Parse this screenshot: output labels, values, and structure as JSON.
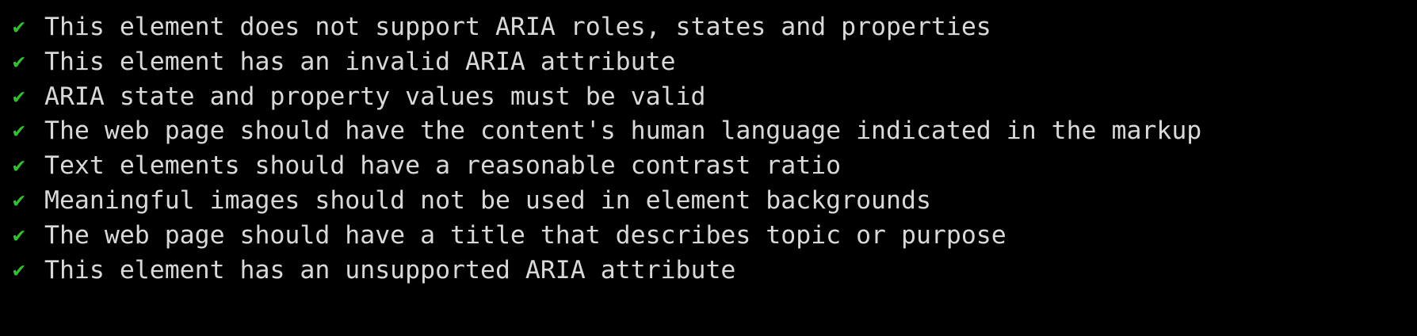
{
  "terminal": {
    "check_color": "#2fc22f",
    "text_color": "#d9d9d9",
    "icon": "check-mark-icon",
    "check_glyph": "✔",
    "lines": [
      "This element does not support ARIA roles, states and properties",
      "This element has an invalid ARIA attribute",
      "ARIA state and property values must be valid",
      "The web page should have the content's human language indicated in the markup",
      "Text elements should have a reasonable contrast ratio",
      "Meaningful images should not be used in element backgrounds",
      "The web page should have a title that describes topic or purpose",
      "This element has an unsupported ARIA attribute"
    ]
  }
}
